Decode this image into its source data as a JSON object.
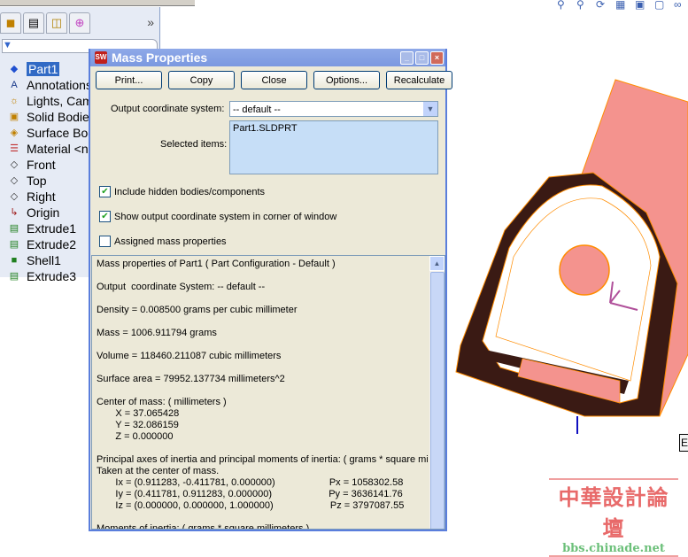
{
  "tree": {
    "tabs": [
      "feature-manager-icon",
      "property-manager-icon",
      "configuration-manager-icon",
      "dim-xpert-icon"
    ],
    "more": "»",
    "items": [
      {
        "label": "Part1",
        "icon": "part-icon",
        "selected": true
      },
      {
        "label": "Annotations",
        "icon": "annotations-icon"
      },
      {
        "label": "Lights, Cameras and Scene",
        "icon": "lights-icon"
      },
      {
        "label": "Solid Bodies",
        "icon": "solid-bodies-icon"
      },
      {
        "label": "Surface Bodies",
        "icon": "surface-bodies-icon"
      },
      {
        "label": "Material <not specified>",
        "icon": "material-icon"
      },
      {
        "label": "Front",
        "icon": "plane-icon"
      },
      {
        "label": "Top",
        "icon": "plane-icon"
      },
      {
        "label": "Right",
        "icon": "plane-icon"
      },
      {
        "label": "Origin",
        "icon": "origin-icon"
      },
      {
        "label": "Extrude1",
        "icon": "extrude-icon"
      },
      {
        "label": "Extrude2",
        "icon": "extrude-icon"
      },
      {
        "label": "Shell1",
        "icon": "shell-icon"
      },
      {
        "label": "Extrude3",
        "icon": "extrude-icon"
      }
    ]
  },
  "dialog": {
    "title": "Mass Properties",
    "logo": "SW",
    "buttons": {
      "print": "Print...",
      "copy": "Copy",
      "close": "Close",
      "options": "Options...",
      "recalculate": "Recalculate"
    },
    "output_cs_label": "Output coordinate system:",
    "output_cs_value": "-- default --",
    "selected_items_label": "Selected items:",
    "selected_items": "Part1.SLDPRT",
    "include_hidden": {
      "label": "Include hidden bodies/components",
      "checked": true
    },
    "show_output_cs": {
      "label": "Show output coordinate system in corner of window",
      "checked": true
    },
    "assigned_mass": {
      "label": "Assigned mass properties",
      "checked": false
    },
    "results": [
      "Mass properties of Part1 ( Part Configuration - Default )",
      "",
      "Output  coordinate System: -- default --",
      "",
      "Density = 0.008500 grams per cubic millimeter",
      "",
      "Mass = 1006.911794 grams",
      "",
      "Volume = 118460.211087 cubic millimeters",
      "",
      "Surface area = 79952.137734 millimeters^2",
      "",
      "Center of mass: ( millimeters )",
      "       X = 37.065428",
      "       Y = 32.086159",
      "       Z = 0.000000",
      "",
      "Principal axes of inertia and principal moments of inertia: ( grams * square millimeters )",
      "Taken at the center of mass.",
      "       Ix = (0.911283, -0.411781, 0.000000)                    Px = 1058302.58",
      "       Iy = (0.411781, 0.911283, 0.000000)                     Py = 3636141.76",
      "       Iz = (0.000000, 0.000000, 1.000000)                     Pz = 3797087.55",
      "",
      "Moments of inertia: ( grams * square millimeters )"
    ]
  },
  "viewport": {
    "tag": "E",
    "part_color": "#f4938e",
    "edge_color": "#ff8c00",
    "dark_color": "#3a1a14"
  },
  "watermark": {
    "cn": "中華設計論壇",
    "en": "bbs.chinade.net"
  }
}
